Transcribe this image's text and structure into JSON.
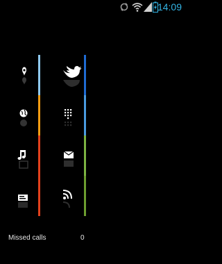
{
  "status_bar": {
    "time": "14:09",
    "icons": [
      "sync-icon",
      "wifi-icon",
      "signal-icon",
      "battery-charging-icon"
    ],
    "time_color": "#33b5e5"
  },
  "tiles": [
    {
      "name": "location",
      "icon": "location-pin-icon",
      "bar_color": "#8fc9ee"
    },
    {
      "name": "twitter",
      "icon": "twitter-bird-icon",
      "bar_color": "#1f6bd1"
    },
    {
      "name": "browser",
      "icon": "globe-icon",
      "bar_color": "#f39c12"
    },
    {
      "name": "dialer",
      "icon": "dialpad-icon",
      "bar_color": "#4a9be0"
    },
    {
      "name": "music",
      "icon": "music-note-icon",
      "bar_color": "#e2411c"
    },
    {
      "name": "email",
      "icon": "envelope-icon",
      "bar_color": "#7cb342"
    },
    {
      "name": "messaging",
      "icon": "message-icon",
      "bar_color": "#e2411c"
    },
    {
      "name": "rss",
      "icon": "rss-feed-icon",
      "bar_color": "#6d9e2f"
    }
  ],
  "missed_calls": {
    "label": "Missed calls",
    "count": "0"
  }
}
